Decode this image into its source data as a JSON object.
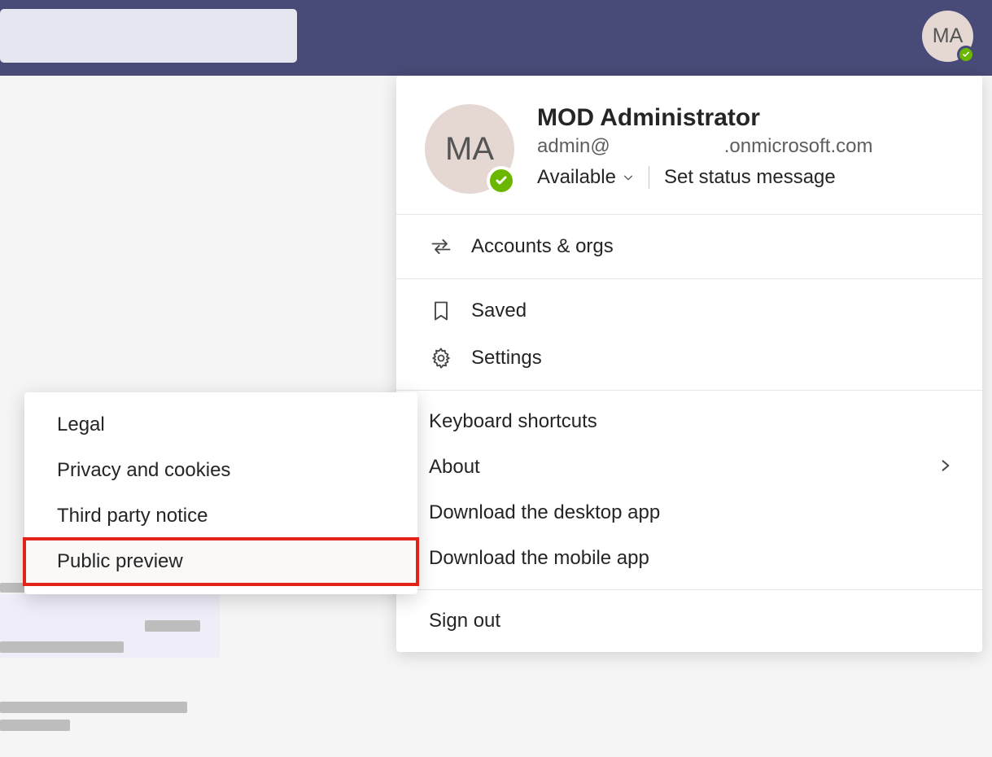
{
  "header": {
    "avatar_initials": "MA"
  },
  "profile": {
    "avatar_initials": "MA",
    "display_name": "MOD Administrator",
    "email_prefix": "admin@",
    "email_suffix": ".onmicrosoft.com",
    "status_label": "Available",
    "set_status_label": "Set status message"
  },
  "menu": {
    "accounts_orgs": "Accounts & orgs",
    "saved": "Saved",
    "settings": "Settings",
    "keyboard_shortcuts": "Keyboard shortcuts",
    "about": "About",
    "download_desktop": "Download the desktop app",
    "download_mobile": "Download the mobile app",
    "sign_out": "Sign out"
  },
  "about_submenu": {
    "legal": "Legal",
    "privacy": "Privacy and cookies",
    "third_party": "Third party notice",
    "public_preview": "Public preview"
  }
}
